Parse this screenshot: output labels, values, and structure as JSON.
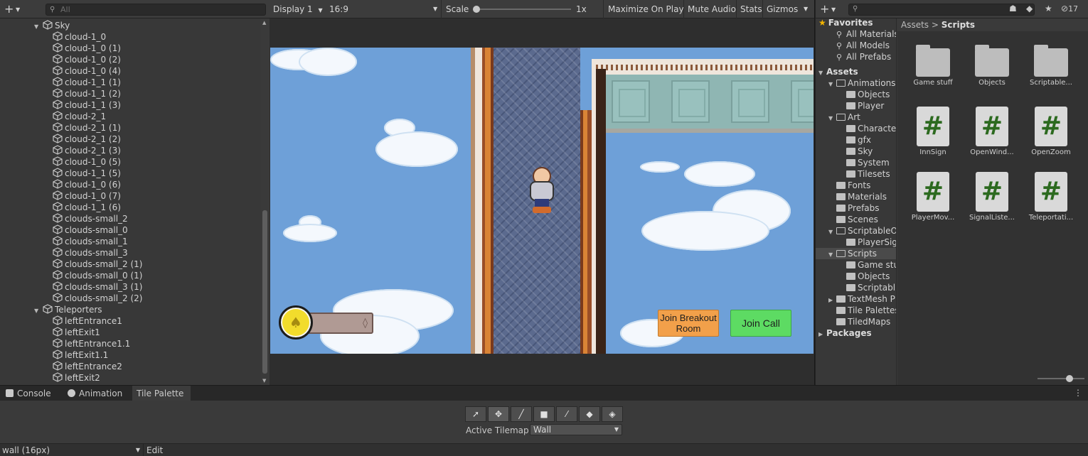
{
  "hierarchy": {
    "search_placeholder": "All",
    "rows": [
      {
        "label": "Sky",
        "depth": 1,
        "expanded": true
      },
      {
        "label": "cloud-1_0",
        "depth": 2
      },
      {
        "label": "cloud-1_0 (1)",
        "depth": 2
      },
      {
        "label": "cloud-1_0 (2)",
        "depth": 2
      },
      {
        "label": "cloud-1_0 (4)",
        "depth": 2
      },
      {
        "label": "cloud-1_1 (1)",
        "depth": 2
      },
      {
        "label": "cloud-1_1 (2)",
        "depth": 2
      },
      {
        "label": "cloud-1_1 (3)",
        "depth": 2
      },
      {
        "label": "cloud-2_1",
        "depth": 2
      },
      {
        "label": "cloud-2_1 (1)",
        "depth": 2
      },
      {
        "label": "cloud-2_1 (2)",
        "depth": 2
      },
      {
        "label": "cloud-2_1 (3)",
        "depth": 2
      },
      {
        "label": "cloud-1_0 (5)",
        "depth": 2
      },
      {
        "label": "cloud-1_1 (5)",
        "depth": 2
      },
      {
        "label": "cloud-1_0 (6)",
        "depth": 2
      },
      {
        "label": "cloud-1_0 (7)",
        "depth": 2
      },
      {
        "label": "cloud-1_1 (6)",
        "depth": 2
      },
      {
        "label": "clouds-small_2",
        "depth": 2
      },
      {
        "label": "clouds-small_0",
        "depth": 2
      },
      {
        "label": "clouds-small_1",
        "depth": 2
      },
      {
        "label": "clouds-small_3",
        "depth": 2
      },
      {
        "label": "clouds-small_2 (1)",
        "depth": 2
      },
      {
        "label": "clouds-small_0 (1)",
        "depth": 2
      },
      {
        "label": "clouds-small_3 (1)",
        "depth": 2
      },
      {
        "label": "clouds-small_2 (2)",
        "depth": 2
      },
      {
        "label": "Teleporters",
        "depth": 1,
        "expanded": true
      },
      {
        "label": "leftEntrance1",
        "depth": 2
      },
      {
        "label": "leftExit1",
        "depth": 2
      },
      {
        "label": "leftEntrance1.1",
        "depth": 2
      },
      {
        "label": "leftExit1.1",
        "depth": 2
      },
      {
        "label": "leftEntrance2",
        "depth": 2
      },
      {
        "label": "leftExit2",
        "depth": 2
      }
    ]
  },
  "game_toolbar": {
    "display": "Display 1",
    "aspect": "16:9",
    "scale_label": "Scale",
    "scale_value": "1x",
    "maximize_on_play": "Maximize On Play",
    "mute_audio": "Mute Audio",
    "stats": "Stats",
    "gizmos": "Gizmos"
  },
  "game_view": {
    "join_breakout_room": "Join Breakout Room",
    "join_call": "Join Call"
  },
  "project": {
    "hidden_count": "17",
    "tree": [
      {
        "label": "Favorites",
        "kind": "favorites",
        "depth": 0,
        "bold": true
      },
      {
        "label": "All Materials",
        "kind": "search",
        "depth": 1
      },
      {
        "label": "All Models",
        "kind": "search",
        "depth": 1
      },
      {
        "label": "All Prefabs",
        "kind": "search",
        "depth": 1
      },
      {
        "label": "Assets",
        "kind": "folder",
        "depth": 0,
        "bold": true,
        "expanded": true
      },
      {
        "label": "Animations",
        "kind": "folder",
        "depth": 1,
        "expanded": true
      },
      {
        "label": "Objects",
        "kind": "folder",
        "depth": 2
      },
      {
        "label": "Player",
        "kind": "folder",
        "depth": 2
      },
      {
        "label": "Art",
        "kind": "folder",
        "depth": 1,
        "expanded": true
      },
      {
        "label": "Characte",
        "kind": "folder",
        "depth": 2
      },
      {
        "label": "gfx",
        "kind": "folder",
        "depth": 2
      },
      {
        "label": "Sky",
        "kind": "folder",
        "depth": 2
      },
      {
        "label": "System",
        "kind": "folder",
        "depth": 2
      },
      {
        "label": "Tilesets",
        "kind": "folder",
        "depth": 2
      },
      {
        "label": "Fonts",
        "kind": "folder",
        "depth": 1
      },
      {
        "label": "Materials",
        "kind": "folder",
        "depth": 1
      },
      {
        "label": "Prefabs",
        "kind": "folder",
        "depth": 1
      },
      {
        "label": "Scenes",
        "kind": "folder",
        "depth": 1
      },
      {
        "label": "ScriptableO",
        "kind": "folder",
        "depth": 1,
        "expanded": true
      },
      {
        "label": "PlayerSig",
        "kind": "folder",
        "depth": 2
      },
      {
        "label": "Scripts",
        "kind": "folder",
        "depth": 1,
        "expanded": true,
        "selected": true
      },
      {
        "label": "Game stu",
        "kind": "folder",
        "depth": 2
      },
      {
        "label": "Objects",
        "kind": "folder",
        "depth": 2
      },
      {
        "label": "Scriptabl",
        "kind": "folder",
        "depth": 2
      },
      {
        "label": "TextMesh P",
        "kind": "folder",
        "depth": 1,
        "collapsed": true
      },
      {
        "label": "Tile Palettes",
        "kind": "folder",
        "depth": 1
      },
      {
        "label": "TiledMaps",
        "kind": "folder",
        "depth": 1
      },
      {
        "label": "Packages",
        "kind": "folder",
        "depth": 0,
        "bold": true,
        "collapsed": true
      }
    ],
    "breadcrumb_root": "Assets",
    "breadcrumb_sep": ">",
    "breadcrumb_current": "Scripts",
    "assets": [
      {
        "label": "Game stuff",
        "type": "folder"
      },
      {
        "label": "Objects",
        "type": "folder"
      },
      {
        "label": "Scriptable...",
        "type": "folder"
      },
      {
        "label": "InnSign",
        "type": "script"
      },
      {
        "label": "OpenWind...",
        "type": "script"
      },
      {
        "label": "OpenZoom",
        "type": "script"
      },
      {
        "label": "PlayerMov...",
        "type": "script"
      },
      {
        "label": "SignalListe...",
        "type": "script"
      },
      {
        "label": "Teleportati...",
        "type": "script"
      }
    ]
  },
  "bottom": {
    "tabs": [
      {
        "label": "Console",
        "icon": "console-icon"
      },
      {
        "label": "Animation",
        "icon": "animation-icon"
      },
      {
        "label": "Tile Palette",
        "icon": "",
        "active": true
      }
    ],
    "active_tilemap_label": "Active Tilemap",
    "active_tilemap_value": "Wall",
    "palette_value": "wall (16px)",
    "edit_label": "Edit",
    "tools": [
      {
        "name": "select-tool",
        "glyph": "➚"
      },
      {
        "name": "move-tool",
        "glyph": "✥"
      },
      {
        "name": "paint-tool",
        "glyph": "╱"
      },
      {
        "name": "box-fill-tool",
        "glyph": "■"
      },
      {
        "name": "pick-tool",
        "glyph": "⁄"
      },
      {
        "name": "erase-tool",
        "glyph": "◆"
      },
      {
        "name": "fill-tool",
        "glyph": "◈"
      }
    ]
  }
}
